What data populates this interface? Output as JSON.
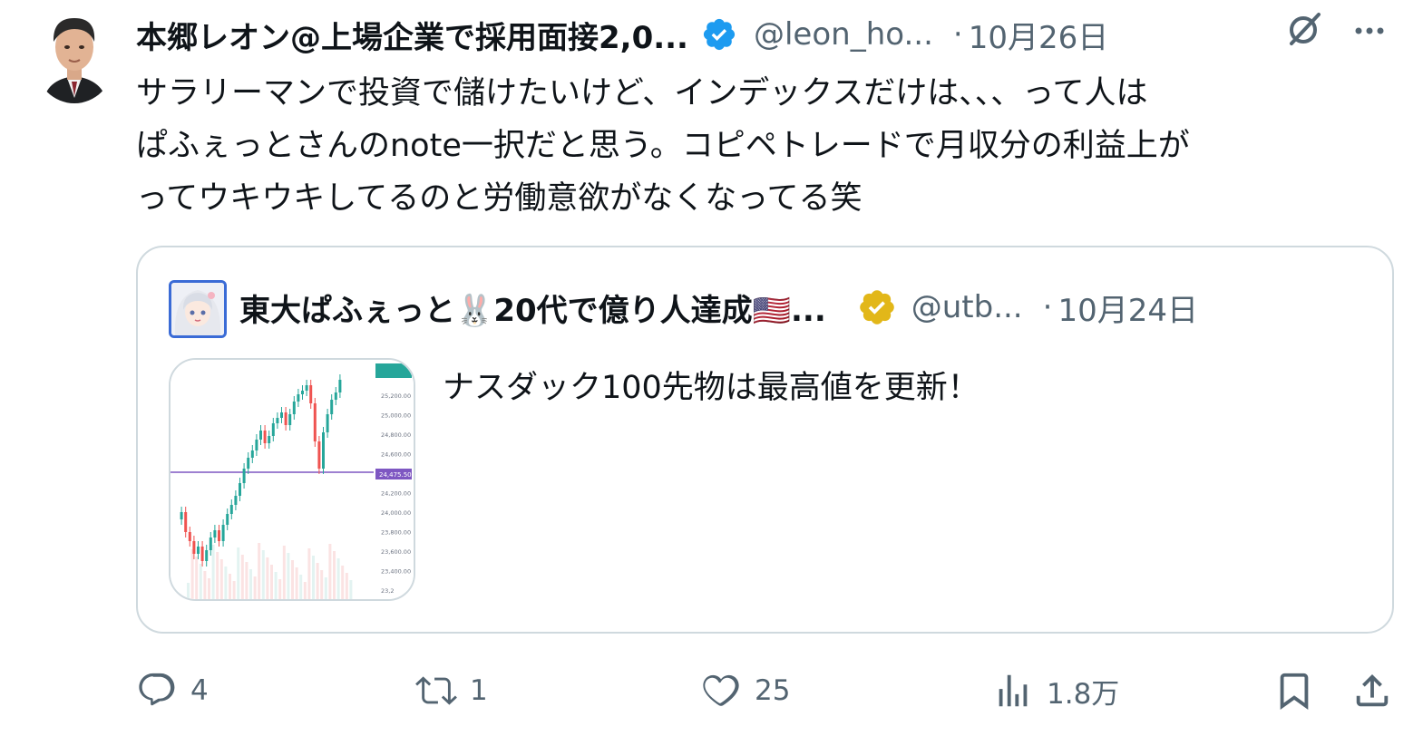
{
  "tweet": {
    "author_name": "本郷レオン@上場企業で採用面接2,0...",
    "handle": "@leon_ho...",
    "separator": "·",
    "date": "10月26日",
    "text_lines": [
      "サラリーマンで投資で儲けたいけど、インデックスだけは、、、って人は",
      "ぱふぇっとさんのnote一択だと思う。コピペトレードで月収分の利益上が",
      "ってウキウキしてるのと労働意欲がなくなってる笑"
    ]
  },
  "quote": {
    "author_name": "東大ぱふぇっと🐰20代で億り人達成🇺🇸...",
    "handle": "@utb...",
    "separator": "·",
    "date": "10月24日",
    "text": "ナスダック100先物は最高値を更新！",
    "thumbnail": {
      "price_labels": [
        "25,200.00",
        "25,000.00",
        "24,800.00",
        "24,600.00",
        "24,475.50",
        "24,200.00",
        "24,000.00",
        "23,800.00",
        "23,600.00",
        "23,400.00",
        "23,2"
      ]
    }
  },
  "actions": {
    "reply_count": "4",
    "retweet_count": "1",
    "like_count": "25",
    "views_count": "1.8万"
  },
  "colors": {
    "text": "#0f1419",
    "secondary": "#536471",
    "verified_blue": "#1d9bf0",
    "verified_gold": "#e2b719",
    "border": "#cfd9de",
    "candle_up": "#26a69a",
    "candle_down": "#ef5350",
    "price_line": "#7e57c2"
  }
}
